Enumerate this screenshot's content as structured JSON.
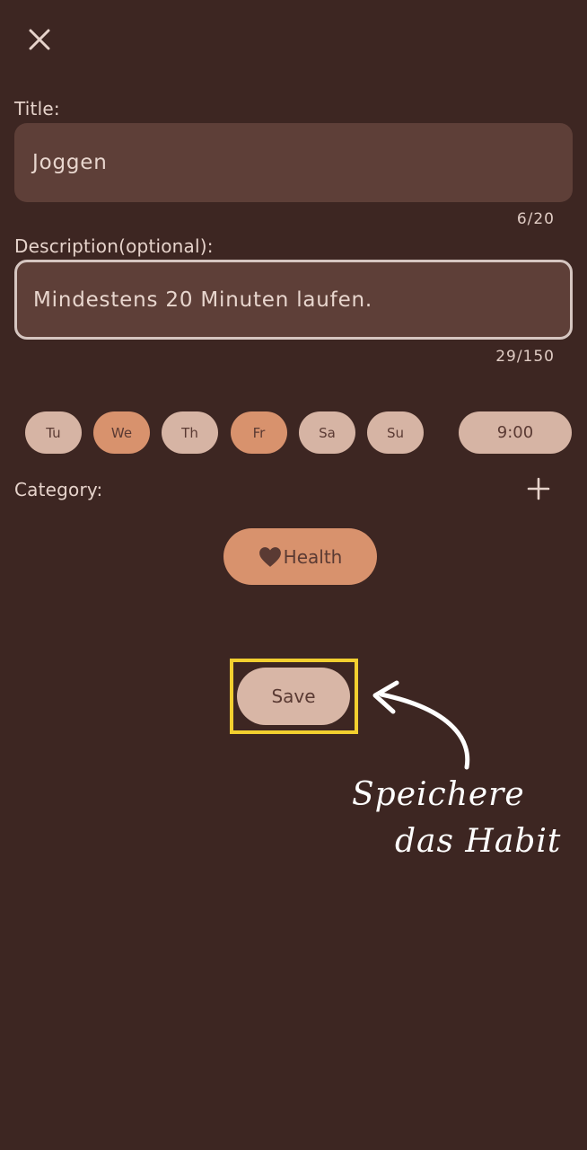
{
  "header": {
    "close_icon": "close-icon"
  },
  "title_field": {
    "label": "Title:",
    "value": "Joggen",
    "counter": "6/20"
  },
  "description_field": {
    "label": "Description(optional):",
    "value": "Mindestens 20 Minuten laufen.",
    "counter": "29/150"
  },
  "days": [
    {
      "label": "Tu",
      "selected": false
    },
    {
      "label": "We",
      "selected": true
    },
    {
      "label": "Th",
      "selected": false
    },
    {
      "label": "Fr",
      "selected": true
    },
    {
      "label": "Sa",
      "selected": false
    },
    {
      "label": "Su",
      "selected": false
    }
  ],
  "time": {
    "value": "9:00"
  },
  "category": {
    "label": "Category:",
    "add_icon": "plus-icon",
    "chip_label": "Health",
    "chip_icon": "heart-icon"
  },
  "save_button": {
    "label": "Save"
  },
  "annotation": {
    "line1": "Speichere",
    "line2": "das Habit"
  },
  "colors": {
    "background": "#3d2622",
    "field": "#5e3f38",
    "pill_off": "#d6b4a4",
    "pill_on": "#d8926d",
    "highlight": "#f2cf2f"
  }
}
